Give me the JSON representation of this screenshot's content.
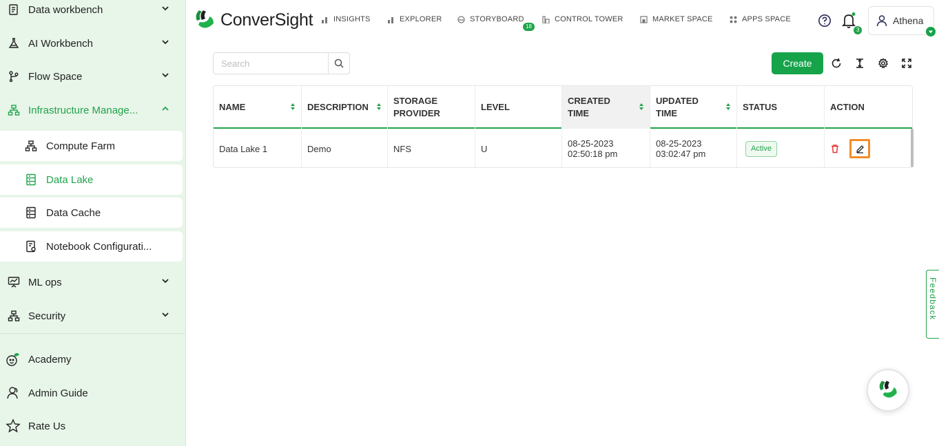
{
  "sidebar": {
    "items": [
      {
        "label": "Data workbench"
      },
      {
        "label": "AI Workbench"
      },
      {
        "label": "Flow Space"
      },
      {
        "label": "Infrastructure Manage..."
      },
      {
        "label": "ML ops"
      },
      {
        "label": "Security"
      }
    ],
    "sub_items": [
      {
        "label": "Compute Farm"
      },
      {
        "label": "Data Lake"
      },
      {
        "label": "Data Cache"
      },
      {
        "label": "Notebook Configurati..."
      }
    ],
    "bottom": [
      {
        "label": "Academy"
      },
      {
        "label": "Admin Guide"
      },
      {
        "label": "Rate Us"
      }
    ]
  },
  "header": {
    "logo_text": "ConverSight",
    "nav": [
      {
        "label": "INSIGHTS"
      },
      {
        "label": "EXPLORER"
      },
      {
        "label": "STORYBOARD",
        "badge": "18"
      },
      {
        "label": "CONTROL TOWER"
      },
      {
        "label": "MARKET SPACE"
      },
      {
        "label": "APPS SPACE"
      }
    ],
    "notifications_count": "3",
    "user_name": "Athena"
  },
  "toolbar": {
    "search_placeholder": "Search",
    "create_label": "Create"
  },
  "table": {
    "columns": [
      {
        "label": "NAME"
      },
      {
        "label": "DESCRIPTION"
      },
      {
        "label": "STORAGE",
        "label2": "PROVIDER"
      },
      {
        "label": "LEVEL"
      },
      {
        "label": "CREATED",
        "label2": "TIME"
      },
      {
        "label": "UPDATED",
        "label2": "TIME"
      },
      {
        "label": "STATUS"
      },
      {
        "label": "ACTION"
      }
    ],
    "rows": [
      {
        "name": "Data Lake 1",
        "description": "Demo",
        "storage_provider": "NFS",
        "level": "U",
        "created_date": "08-25-2023",
        "created_time": "02:50:18 pm",
        "updated_date": "08-25-2023",
        "updated_time": "03:02:47 pm",
        "status": "Active"
      }
    ]
  },
  "feedback_label": "Feedback",
  "colors": {
    "accent": "#20a34a",
    "sidebar_bg": "#e8f5e9",
    "highlight": "#f28c28",
    "danger": "#e53935"
  }
}
